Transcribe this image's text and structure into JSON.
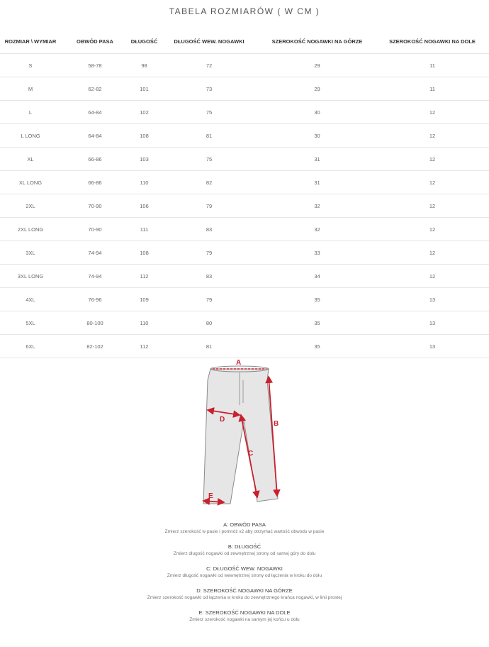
{
  "title": "TABELA ROZMIARÓW ( W CM )",
  "table": {
    "headers": [
      "ROZMIAR \\ WYMIAR",
      "OBWÓD PASA",
      "DŁUGOŚĆ",
      "DŁUGOŚĆ WEW. NOGAWKI",
      "SZEROKOŚĆ NOGAWKI NA GÓRZE",
      "SZEROKOŚĆ NOGAWKI NA DOLE"
    ],
    "rows": [
      [
        "S",
        "58-78",
        "98",
        "72",
        "29",
        "11"
      ],
      [
        "M",
        "62-82",
        "101",
        "73",
        "29",
        "11"
      ],
      [
        "L",
        "64-84",
        "102",
        "75",
        "30",
        "12"
      ],
      [
        "L LONG",
        "64-84",
        "108",
        "81",
        "30",
        "12"
      ],
      [
        "XL",
        "66-86",
        "103",
        "75",
        "31",
        "12"
      ],
      [
        "XL LONG",
        "66-86",
        "110",
        "82",
        "31",
        "12"
      ],
      [
        "2XL",
        "70-90",
        "106",
        "79",
        "32",
        "12"
      ],
      [
        "2XL LONG",
        "70-90",
        "111",
        "83",
        "32",
        "12"
      ],
      [
        "3XL",
        "74-94",
        "108",
        "79",
        "33",
        "12"
      ],
      [
        "3XL LONG",
        "74-94",
        "112",
        "83",
        "34",
        "12"
      ],
      [
        "4XL",
        "76-96",
        "109",
        "79",
        "35",
        "13"
      ],
      [
        "5XL",
        "80-100",
        "110",
        "80",
        "35",
        "13"
      ],
      [
        "6XL",
        "82-102",
        "112",
        "81",
        "35",
        "13"
      ]
    ]
  },
  "diagram": {
    "labels": {
      "a": "A",
      "b": "B",
      "c": "C",
      "d": "D",
      "e": "E"
    },
    "arrow_color": "#c8202f",
    "pants_fill": "#e6e6e6",
    "outline_color": "#8a8a8a"
  },
  "legend": [
    {
      "heading": "A: OBWÓD PASA",
      "desc": "Zmierz szerokość w pasie i pomnóż x2 aby otrzymać wartość obwodu w pasie"
    },
    {
      "heading": "B: DŁUGOŚĆ",
      "desc": "Zmierz długość nogawki od zewnętrznej strony od samej góry do dołu"
    },
    {
      "heading": "C: DŁUGOŚĆ WEW. NOGAWKI",
      "desc": "Zmierz długość nogawki od wewnętrznej strony od łączenia w kroku do dołu"
    },
    {
      "heading": "D: SZEROKOŚĆ NOGAWKI NA GÓRZE",
      "desc": "Zmierz szerokość nogawki od łączenia w kroku do zewnętrznego krańca nogawki, w linii prostej"
    },
    {
      "heading": "E: SZEROKOŚĆ NOGAWKI NA DOLE",
      "desc": "Zmierz szerokość nogawki na samym jej końcu u dołu"
    }
  ]
}
